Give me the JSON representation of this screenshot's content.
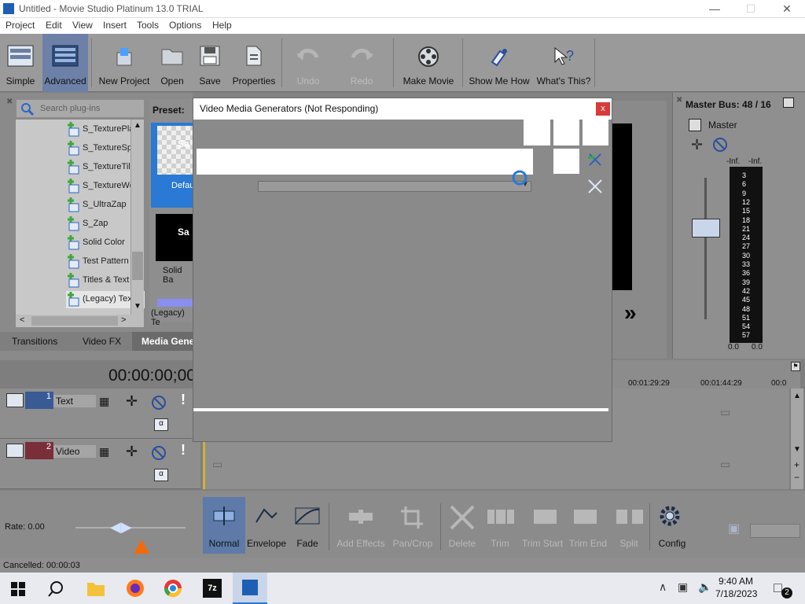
{
  "window": {
    "title": "Untitled - Movie Studio Platinum 13.0 TRIAL"
  },
  "menu": [
    "Project",
    "Edit",
    "View",
    "Insert",
    "Tools",
    "Options",
    "Help"
  ],
  "toolbar": {
    "simple": "Simple",
    "advanced": "Advanced",
    "new_project": "New Project",
    "open": "Open",
    "save": "Save",
    "properties": "Properties",
    "undo": "Undo",
    "redo": "Redo",
    "make_movie": "Make Movie",
    "show_me_how": "Show Me How",
    "whats_this": "What's This?"
  },
  "left_panel": {
    "search_placeholder": "Search plug-ins",
    "preset_label": "Preset:",
    "items": [
      "S_TexturePla",
      "S_TextureSp",
      "S_TextureTil",
      "S_TextureWe",
      "S_UltraZap",
      "S_Zap",
      "Solid Color",
      "Test Pattern",
      "Titles & Text",
      "(Legacy) Tex"
    ],
    "preset_default": "Defau",
    "preset_solid": "Solid Ba",
    "preset_legacy": "(Legacy) Te",
    "thumb1_text": "Sa",
    "thumb2_text": "Sa",
    "tabs": [
      "Transitions",
      "Video FX",
      "Media Gene"
    ]
  },
  "dialog": {
    "title": "Video Media Generators (Not Responding)",
    "close": "x"
  },
  "master": {
    "label": "Master Bus: 48 / 16",
    "bus_name": "Master",
    "inf_left": "-Inf.",
    "inf_right": "-Inf.",
    "zero_left": "0.0",
    "zero_right": "0.0",
    "scale": [
      "3",
      "6",
      "9",
      "12",
      "15",
      "18",
      "21",
      "24",
      "27",
      "30",
      "33",
      "36",
      "39",
      "42",
      "45",
      "48",
      "51",
      "54",
      "57"
    ]
  },
  "timeline": {
    "timecode": "00:00:00;00",
    "ruler_marks": [
      "00:01:29:29",
      "00:01:44:29",
      "00:0"
    ],
    "tracks": [
      {
        "num": "1",
        "name": "Text"
      },
      {
        "num": "2",
        "name": "Video"
      }
    ]
  },
  "bottom_toolbar": {
    "rate": "Rate: 0.00",
    "normal": "Normal",
    "envelope": "Envelope",
    "fade": "Fade",
    "add_effects": "Add Effects",
    "pan_crop": "Pan/Crop",
    "delete": "Delete",
    "trim": "Trim",
    "trim_start": "Trim Start",
    "trim_end": "Trim End",
    "split": "Split",
    "config": "Config"
  },
  "status": "Cancelled: 00:00:03",
  "taskbar": {
    "time": "9:40 AM",
    "date": "7/18/2023",
    "notifications": "2",
    "app_7z": "7z"
  },
  "colors": {
    "accent_blue": "#2a79d4",
    "close_red": "#d93a3a",
    "orange_marker": "#f26a0c"
  }
}
